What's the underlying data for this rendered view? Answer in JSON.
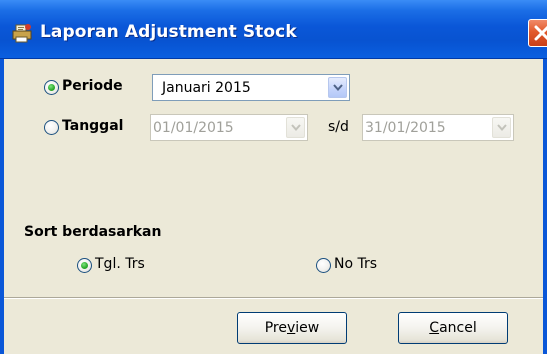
{
  "window": {
    "title": "Laporan Adjustment Stock",
    "app_icon": "printer-report-icon",
    "close_icon": "close-icon"
  },
  "filter": {
    "periode": {
      "label": "Periode",
      "selected": true,
      "value": "Januari 2015"
    },
    "tanggal": {
      "label": "Tanggal",
      "selected": false,
      "from": "01/01/2015",
      "separator": "s/d",
      "to": "31/01/2015",
      "disabled": true
    }
  },
  "sort": {
    "heading": "Sort berdasarkan",
    "options": [
      {
        "label": "Tgl. Trs",
        "selected": true
      },
      {
        "label": "No Trs",
        "selected": false
      }
    ]
  },
  "buttons": {
    "preview": {
      "pre": "Pre",
      "accel": "v",
      "post": "iew"
    },
    "cancel": {
      "pre": "",
      "accel": "C",
      "post": "ancel"
    }
  },
  "colors": {
    "titlebar": "#0a57d8",
    "face": "#ece9d8",
    "radio_dot": "#2fae2f",
    "close": "#e25a2c"
  }
}
